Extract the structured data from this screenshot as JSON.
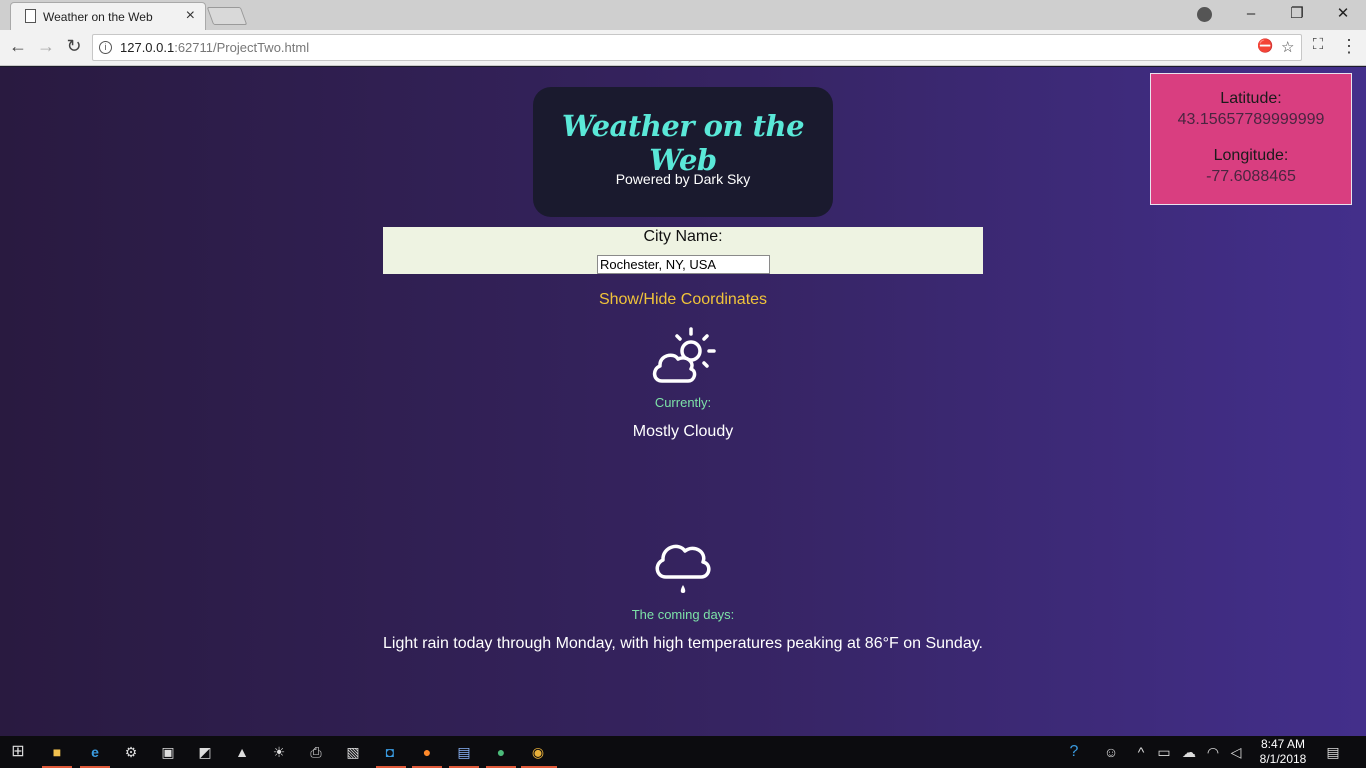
{
  "browser": {
    "tab_title": "Weather on the Web",
    "url_host": "127.0.0.1",
    "url_rest": ":62711/ProjectTwo.html"
  },
  "header": {
    "title": "Weather on the Web",
    "subtitle": "Powered by Dark Sky"
  },
  "coordinates": {
    "latitude_label": "Latitude:",
    "latitude_value": "43.15657789999999",
    "longitude_label": "Longitude:",
    "longitude_value": "-77.6088465"
  },
  "city": {
    "label": "City Name:",
    "value": "Rochester, NY, USA"
  },
  "toggle_label": "Show/Hide Coordinates",
  "current": {
    "icon": "partly-cloudy-day-icon",
    "label": "Currently:",
    "summary": "Mostly Cloudy"
  },
  "forecast": {
    "icon": "rain-icon",
    "label": "The coming days:",
    "summary": "Light rain today through Monday, with high temperatures peaking at 86°F on Sunday."
  },
  "taskbar": {
    "time": "8:47 AM",
    "date": "8/1/2018"
  },
  "colors": {
    "title": "#5ae8d8",
    "coords_panel": "#d93e80",
    "toggle_link": "#f0c33a",
    "section_label": "#7de2a8"
  }
}
